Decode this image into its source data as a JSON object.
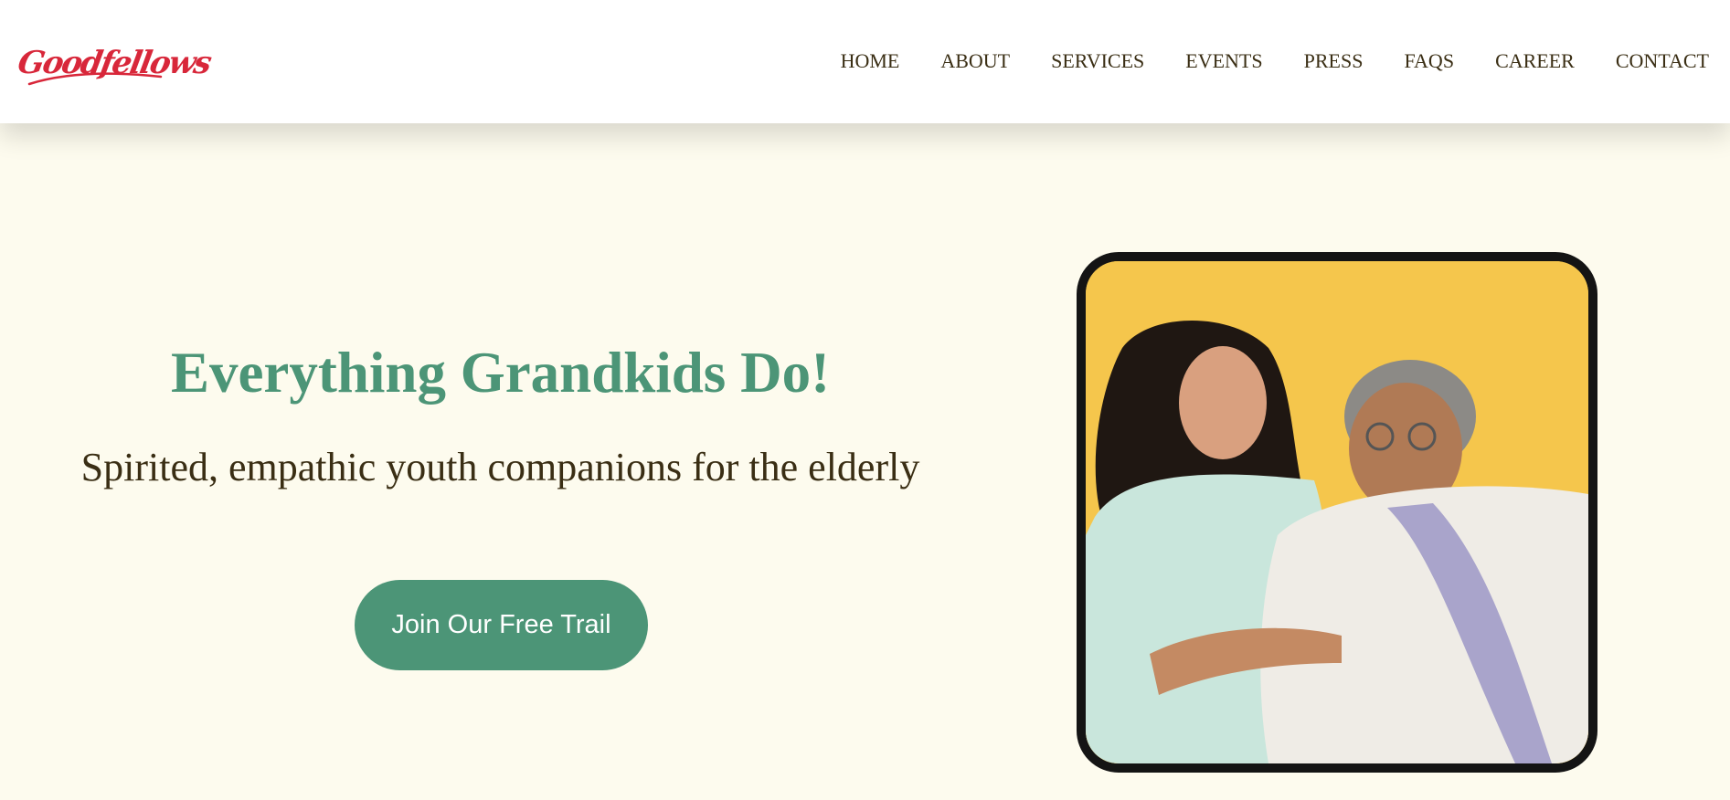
{
  "brand": {
    "logo_text": "Goodfellows",
    "logo_color": "#d8273a"
  },
  "nav": {
    "items": [
      {
        "label": "HOME"
      },
      {
        "label": "ABOUT"
      },
      {
        "label": "SERVICES"
      },
      {
        "label": "EVENTS"
      },
      {
        "label": "PRESS"
      },
      {
        "label": "FAQS"
      },
      {
        "label": "CAREER"
      },
      {
        "label": "CONTACT"
      }
    ]
  },
  "hero": {
    "title": "Everything Grandkids Do!",
    "subtitle": "Spirited, empathic youth companions for the elderly",
    "cta_label": "Join Our Free Trail",
    "image_alt": "Young woman laughing with an elderly woman"
  },
  "colors": {
    "accent": "#4c9577",
    "background": "#fdfbee",
    "text": "#3a2e14",
    "photo_background": "#f5c64c"
  }
}
